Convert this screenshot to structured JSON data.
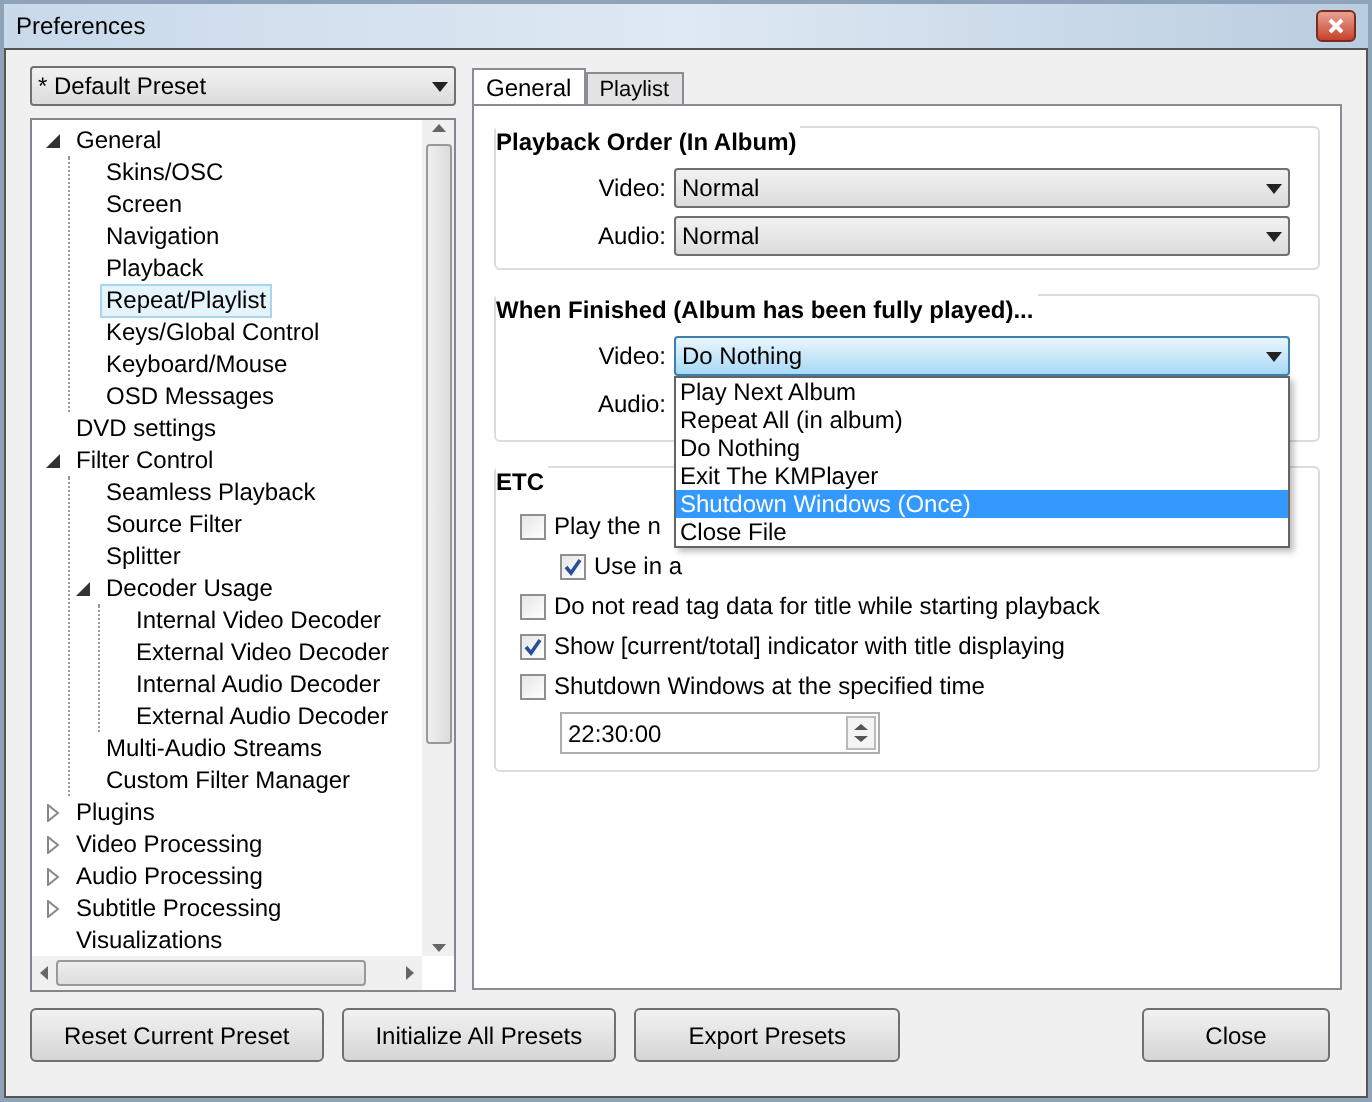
{
  "window": {
    "title": "Preferences"
  },
  "preset": {
    "value": "* Default Preset"
  },
  "tree": [
    {
      "label": "General",
      "expanded": true,
      "selected": false,
      "children": [
        {
          "label": "Skins/OSC",
          "selected": false
        },
        {
          "label": "Screen",
          "selected": false
        },
        {
          "label": "Navigation",
          "selected": false
        },
        {
          "label": "Playback",
          "selected": false
        },
        {
          "label": "Repeat/Playlist",
          "selected": true
        },
        {
          "label": "Keys/Global Control",
          "selected": false
        },
        {
          "label": "Keyboard/Mouse",
          "selected": false
        },
        {
          "label": "OSD Messages",
          "selected": false
        }
      ]
    },
    {
      "label": "DVD settings",
      "selected": false
    },
    {
      "label": "Filter Control",
      "expanded": true,
      "selected": false,
      "children": [
        {
          "label": "Seamless Playback",
          "selected": false
        },
        {
          "label": "Source Filter",
          "selected": false
        },
        {
          "label": "Splitter",
          "selected": false
        },
        {
          "label": "Decoder Usage",
          "expanded": true,
          "selected": false,
          "children": [
            {
              "label": "Internal Video Decoder",
              "selected": false
            },
            {
              "label": "External Video Decoder",
              "selected": false
            },
            {
              "label": "Internal Audio Decoder",
              "selected": false
            },
            {
              "label": "External Audio Decoder",
              "selected": false
            }
          ]
        },
        {
          "label": "Multi-Audio Streams",
          "selected": false
        },
        {
          "label": "Custom Filter Manager",
          "selected": false
        }
      ]
    },
    {
      "label": "Plugins",
      "expanded": false,
      "selected": false
    },
    {
      "label": "Video Processing",
      "expanded": false,
      "selected": false
    },
    {
      "label": "Audio Processing",
      "expanded": false,
      "selected": false
    },
    {
      "label": "Subtitle Processing",
      "expanded": false,
      "selected": false
    },
    {
      "label": "Visualizations",
      "selected": false
    }
  ],
  "tabs": [
    {
      "label": "General",
      "selected": true
    },
    {
      "label": "Playlist",
      "selected": false
    }
  ],
  "playback_order": {
    "title": "Playback Order (In Album)",
    "rows": [
      {
        "label": "Video:",
        "value": "Normal"
      },
      {
        "label": "Audio:",
        "value": "Normal"
      }
    ]
  },
  "when_finished": {
    "title": "When Finished (Album has been fully played)...",
    "video": {
      "label": "Video:",
      "value": "Do Nothing"
    },
    "audio": {
      "label": "Audio:"
    },
    "options": [
      {
        "label": "Play Next Album",
        "selected": false
      },
      {
        "label": "Repeat All (in album)",
        "selected": false
      },
      {
        "label": "Do Nothing",
        "selected": false
      },
      {
        "label": "Exit The KMPlayer",
        "selected": false
      },
      {
        "label": "Shutdown Windows (Once)",
        "selected": true
      },
      {
        "label": "Close File",
        "selected": false
      }
    ]
  },
  "etc": {
    "title": "ETC",
    "options": [
      {
        "label": "Play the n",
        "checked": false,
        "kind": "main"
      },
      {
        "label": "Use in a",
        "checked": true,
        "kind": "sub"
      },
      {
        "label": "Do not read tag data for title while starting playback",
        "checked": false,
        "kind": "main"
      },
      {
        "label": "Show [current/total] indicator with title displaying",
        "checked": true,
        "kind": "main"
      },
      {
        "label": "Shutdown Windows at the specified time",
        "checked": false,
        "kind": "main"
      }
    ],
    "time": "22:30:00"
  },
  "buttons": [
    "Reset Current Preset",
    "Initialize All Presets",
    "Export Presets"
  ],
  "close_button": "Close"
}
